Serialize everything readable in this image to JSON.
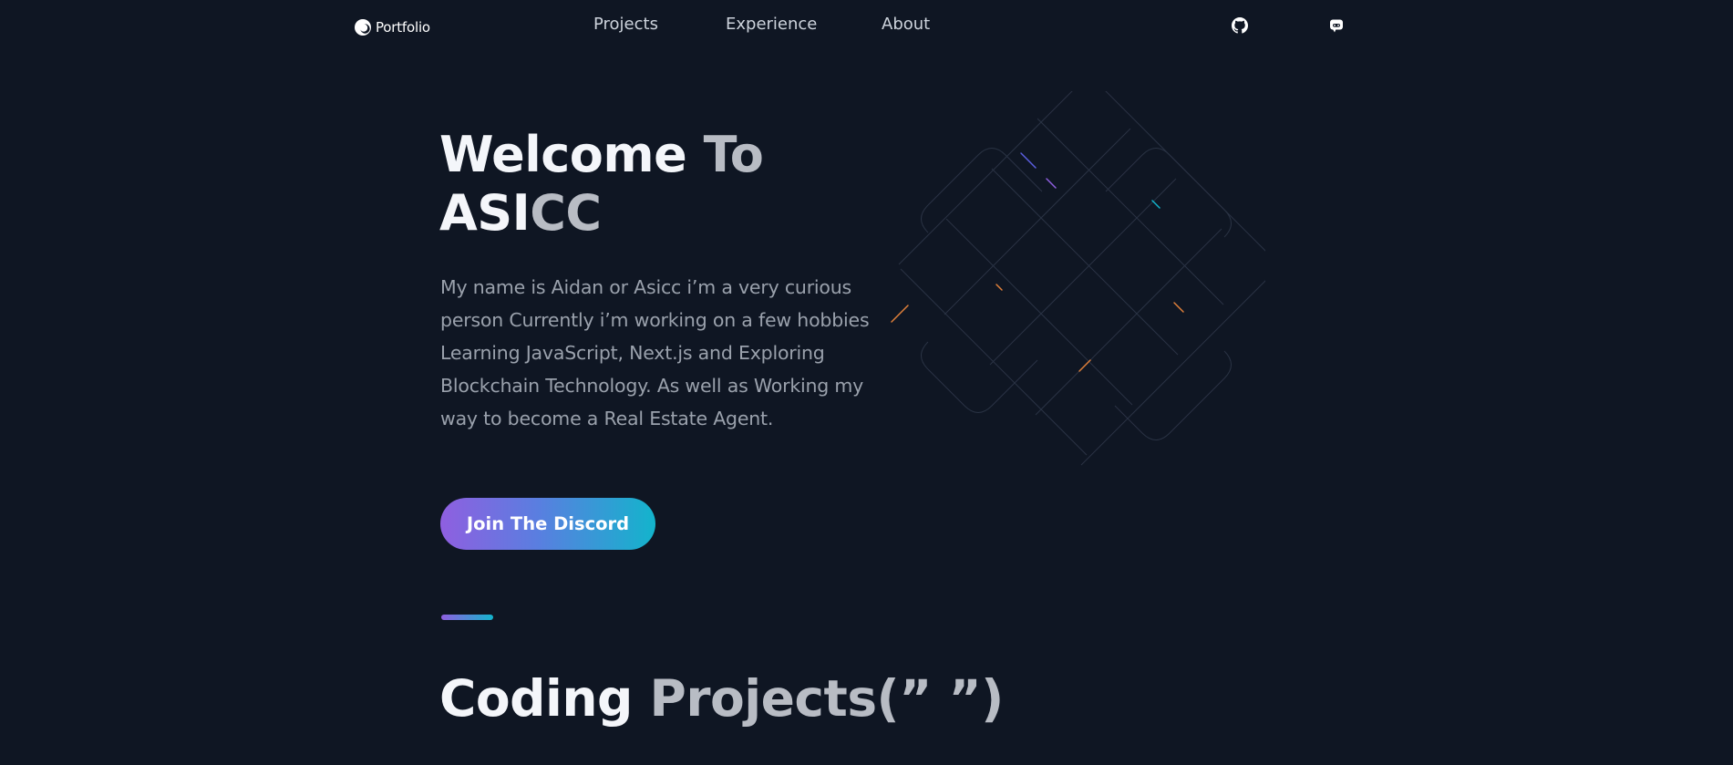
{
  "header": {
    "logo_label": "Portfolio",
    "logo_icon": "portfolio-logo-icon",
    "nav": {
      "projects": "Projects",
      "experience": "Experience",
      "about": "About"
    },
    "social": {
      "github_icon": "github-icon",
      "discord_icon": "discord-icon"
    }
  },
  "hero": {
    "title_line1_white": "Welcome ",
    "title_line1_grey": "To",
    "title_line2_white": "ASI",
    "title_line2_grey": "CC",
    "description": "My name is Aidan or Asicc i’m a very curious person Currently i’m working on a few hobbies Learning JavaScript, Next.js and Exploring Blockchain Technology. As well as Working my way to become a Real Estate Agent.",
    "cta_label": "Join The Discord",
    "graphic_icon": "grid-lines-graphic-icon"
  },
  "projects_section": {
    "title_white": "Coding ",
    "title_grey": "Projects(” ”)"
  },
  "colors": {
    "background": "#0f1623",
    "gradient_start": "#8f5fe0",
    "gradient_end": "#13b4cc",
    "text_grey": "#9aa1ac"
  }
}
